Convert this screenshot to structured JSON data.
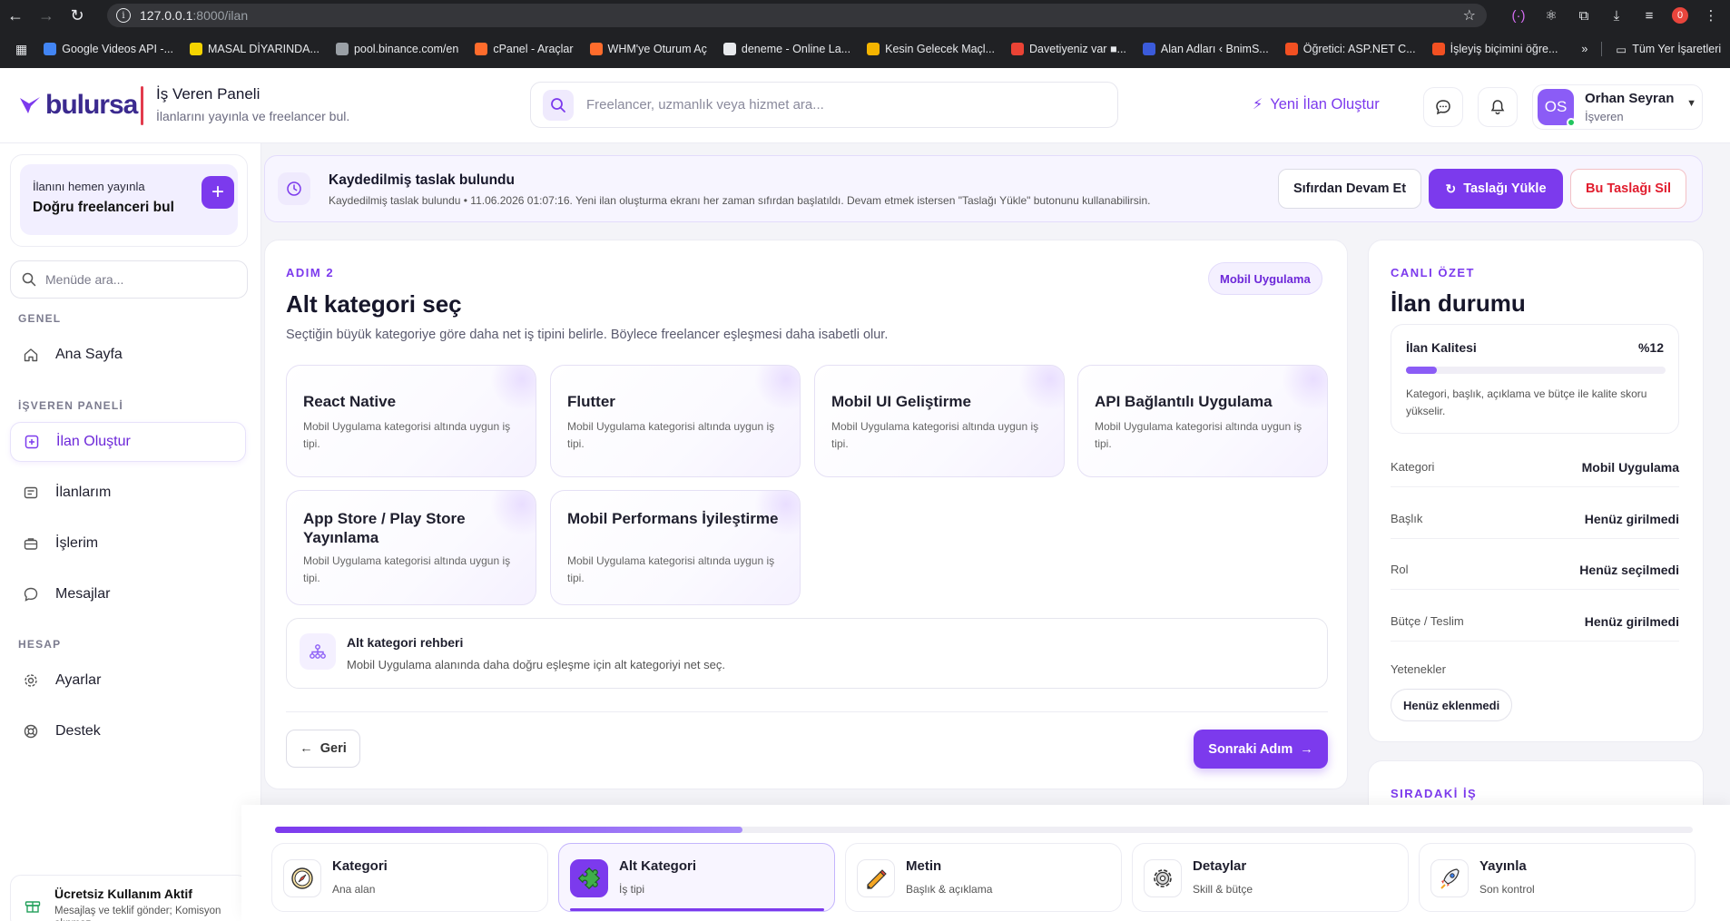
{
  "browser": {
    "url_host": "127.0.0.1",
    "url_path": ":8000/ilan",
    "profile_badge": "0",
    "bookmarks": [
      {
        "label": "Google Videos API -...",
        "color": "#4285f4"
      },
      {
        "label": "MASAL DİYARINDA...",
        "color": "#f5d400"
      },
      {
        "label": "pool.binance.com/en",
        "color": "#9aa0a6"
      },
      {
        "label": "cPanel - Araçlar",
        "color": "#ff6c2c"
      },
      {
        "label": "WHM'ye Oturum Aç",
        "color": "#ff6c2c"
      },
      {
        "label": "deneme - Online La...",
        "color": "#e8eaed"
      },
      {
        "label": "Kesin Gelecek Maçl...",
        "color": "#f4b400"
      },
      {
        "label": "Davetiyeniz var ■...",
        "color": "#ea4335"
      },
      {
        "label": "Alan Adları ‹ BnimS...",
        "color": "#3b5bdb"
      },
      {
        "label": "Öğretici: ASP.NET C...",
        "color": "#f25022"
      },
      {
        "label": "İşleyiş biçimini öğre...",
        "color": "#f25022"
      }
    ],
    "more": "»",
    "all_bookmarks": "Tüm Yer İşaretleri"
  },
  "header": {
    "logo": "bulursa",
    "panel_title": "İş Veren Paneli",
    "panel_subtitle": "İlanlarını yayınla ve freelancer bul.",
    "search_placeholder": "Freelancer, uzmanlık veya hizmet ara...",
    "new_ad": "Yeni İlan Oluştur",
    "user_initials": "OS",
    "user_name": "Orhan Seyran",
    "user_role": "İşveren",
    "brand_color": "#7c3aed"
  },
  "sidebar": {
    "promo_small": "İlanını hemen yayınla",
    "promo_big": "Doğru freelanceri bul",
    "menu_search_placeholder": "Menüde ara...",
    "section_general": "GENEL",
    "section_employer": "İŞVEREN PANELİ",
    "section_account": "HESAP",
    "items": {
      "home": "Ana Sayfa",
      "create": "İlan Oluştur",
      "my_ads": "İlanlarım",
      "jobs": "İşlerim",
      "messages": "Mesajlar",
      "settings": "Ayarlar",
      "support": "Destek"
    },
    "free_title": "Ücretsiz Kullanım Aktif",
    "free_sub": "Mesajlaş ve teklif gönder; Komisyon alınmaz"
  },
  "draft": {
    "title": "Kaydedilmiş taslak bulundu",
    "subtitle": "Kaydedilmiş taslak bulundu • 11.06.2026 01:07:16. Yeni ilan oluşturma ekranı her zaman sıfırdan başlatıldı. Devam etmek istersen \"Taslağı Yükle\" butonunu kullanabilirsin.",
    "btn_fresh": "Sıfırdan Devam Et",
    "btn_load": "Taslağı Yükle",
    "btn_delete": "Bu Taslağı Sil"
  },
  "step": {
    "label": "ADIM 2",
    "title": "Alt kategori seç",
    "desc": "Seçtiğin büyük kategoriye göre daha net iş tipini belirle. Böylece freelancer eşleşmesi daha isabetli olur.",
    "category_chip": "Mobil Uygulama",
    "options": [
      {
        "title": "React Native",
        "desc": "Mobil Uygulama kategorisi altında uygun iş tipi."
      },
      {
        "title": "Flutter",
        "desc": "Mobil Uygulama kategorisi altında uygun iş tipi."
      },
      {
        "title": "Mobil UI Geliştirme",
        "desc": "Mobil Uygulama kategorisi altında uygun iş tipi."
      },
      {
        "title": "API Bağlantılı Uygulama",
        "desc": "Mobil Uygulama kategorisi altında uygun iş tipi."
      },
      {
        "title": "App Store / Play Store Yayınlama",
        "desc": "Mobil Uygulama kategorisi altında uygun iş tipi."
      },
      {
        "title": "Mobil Performans İyileştirme",
        "desc": "Mobil Uygulama kategorisi altında uygun iş tipi."
      }
    ],
    "guide_title": "Alt kategori rehberi",
    "guide_desc": "Mobil Uygulama alanında daha doğru eşleşme için alt kategoriyi net seç.",
    "back": "Geri",
    "next": "Sonraki Adım"
  },
  "summary": {
    "label": "CANLI ÖZET",
    "title": "İlan durumu",
    "quality_name": "İlan Kalitesi",
    "quality_value": "%12",
    "quality_fraction": 0.12,
    "quality_desc": "Kategori, başlık, açıklama ve bütçe ile kalite skoru yükselir.",
    "rows": [
      {
        "key": "Kategori",
        "value": "Mobil Uygulama"
      },
      {
        "key": "Başlık",
        "value": "Henüz girilmedi"
      },
      {
        "key": "Rol",
        "value": "Henüz seçilmedi"
      },
      {
        "key": "Bütçe / Teslim",
        "value": "Henüz girilmedi"
      }
    ],
    "skills_label": "Yetenekler",
    "skills_chip": "Henüz eklenmedi",
    "next_label": "SIRADAKİ İŞ"
  },
  "stepper": {
    "progress_fraction": 0.33,
    "steps": [
      {
        "title": "Kategori",
        "desc": "Ana alan",
        "icon": "compass-icon"
      },
      {
        "title": "Alt Kategori",
        "desc": "İş tipi",
        "icon": "puzzle-icon"
      },
      {
        "title": "Metin",
        "desc": "Başlık & açıklama",
        "icon": "pencil-icon"
      },
      {
        "title": "Detaylar",
        "desc": "Skill & bütçe",
        "icon": "gear-icon"
      },
      {
        "title": "Yayınla",
        "desc": "Son kontrol",
        "icon": "rocket-icon"
      }
    ]
  }
}
